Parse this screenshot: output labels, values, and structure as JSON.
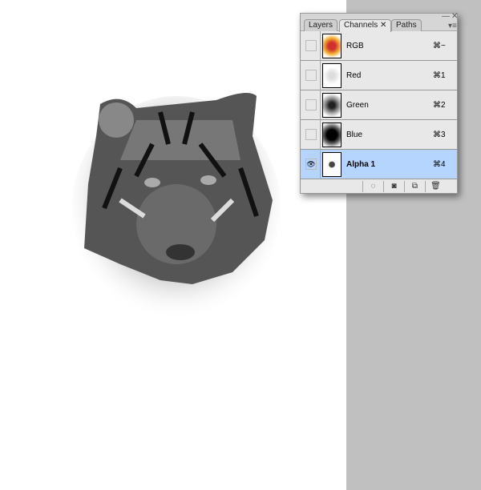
{
  "panel": {
    "tabs": [
      {
        "label": "Layers"
      },
      {
        "label": "Channels"
      },
      {
        "label": "Paths"
      }
    ],
    "channels": [
      {
        "name": "RGB",
        "shortcut": "⌘~",
        "visible": false,
        "selected": false
      },
      {
        "name": "Red",
        "shortcut": "⌘1",
        "visible": false,
        "selected": false
      },
      {
        "name": "Green",
        "shortcut": "⌘2",
        "visible": false,
        "selected": false
      },
      {
        "name": "Blue",
        "shortcut": "⌘3",
        "visible": false,
        "selected": false
      },
      {
        "name": "Alpha 1",
        "shortcut": "⌘4",
        "visible": true,
        "selected": true
      }
    ],
    "selected_color": "#b5d5fe"
  }
}
